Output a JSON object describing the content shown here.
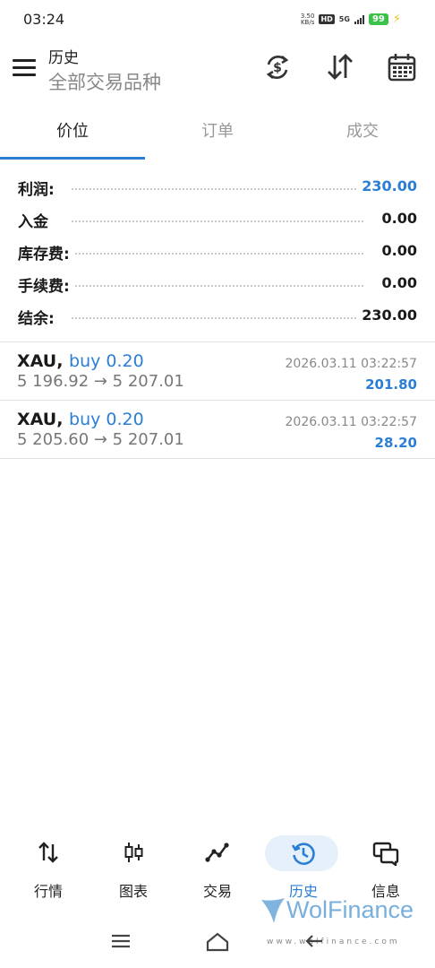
{
  "status": {
    "time": "03:24",
    "net_speed_top": "3.50",
    "net_speed_bottom": "KB/s",
    "hd": "HD",
    "network": "5G",
    "battery": "99"
  },
  "header": {
    "title": "历史",
    "subtitle": "全部交易品种",
    "icons": [
      "menu-icon",
      "currency-exchange-icon",
      "sort-icon",
      "calendar-icon"
    ]
  },
  "tabs": [
    {
      "label": "价位",
      "active": true
    },
    {
      "label": "订单",
      "active": false
    },
    {
      "label": "成交",
      "active": false
    }
  ],
  "summary": [
    {
      "label": "利润:",
      "value": "230.00",
      "highlight": true
    },
    {
      "label": "入金",
      "value": "0.00",
      "highlight": false
    },
    {
      "label": "库存费:",
      "value": "0.00",
      "highlight": false
    },
    {
      "label": "手续费:",
      "value": "0.00",
      "highlight": false
    },
    {
      "label": "结余:",
      "value": "230.00",
      "highlight": false
    }
  ],
  "deals": [
    {
      "symbol": "XAU,",
      "side": "buy 0.20",
      "prices": "5 196.92 → 5 207.01",
      "time": "2026.03.11 03:22:57",
      "profit": "201.80"
    },
    {
      "symbol": "XAU,",
      "side": "buy 0.20",
      "prices": "5 205.60 → 5 207.01",
      "time": "2026.03.11 03:22:57",
      "profit": "28.20"
    }
  ],
  "bottom_nav": [
    {
      "label": "行情",
      "icon": "quotes-arrows-icon",
      "active": false
    },
    {
      "label": "图表",
      "icon": "candlestick-chart-icon",
      "active": false
    },
    {
      "label": "交易",
      "icon": "trade-line-icon",
      "active": false
    },
    {
      "label": "历史",
      "icon": "history-clock-icon",
      "active": true
    },
    {
      "label": "信息",
      "icon": "messages-icon",
      "active": false
    }
  ],
  "watermark": {
    "brand": "WolFinance",
    "url": "www.wolfinance.com"
  },
  "colors": {
    "accent": "#2a7fd4",
    "nav_active_bg": "#e6f0fa",
    "battery": "#3cc14a"
  }
}
